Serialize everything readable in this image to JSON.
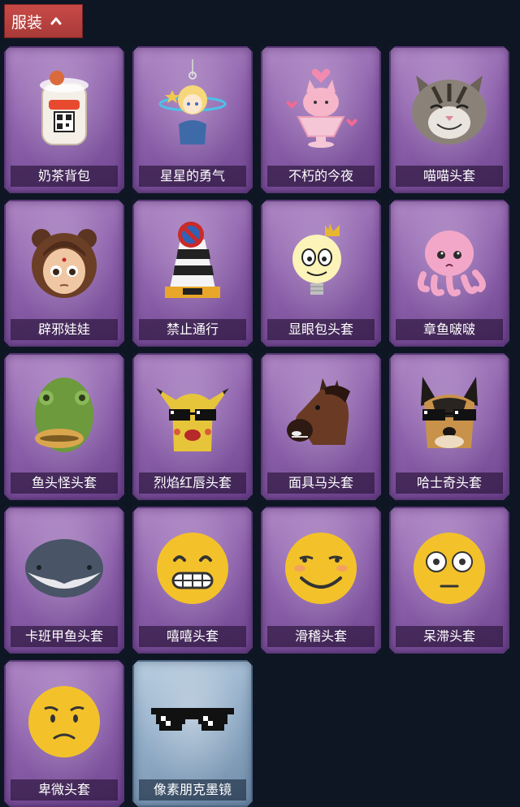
{
  "header": {
    "tab_label": "服装",
    "tab_icon": "chevron-up-icon",
    "tab_color": "#b8403e"
  },
  "items": [
    {
      "name": "奶茶背包",
      "icon": "milk-tea-backpack",
      "frame": "purple"
    },
    {
      "name": "星星的勇气",
      "icon": "star-courage-charm",
      "frame": "purple"
    },
    {
      "name": "不朽的今夜",
      "icon": "pink-fox-dessert-cup",
      "frame": "purple"
    },
    {
      "name": "喵喵头套",
      "icon": "cat-head",
      "frame": "purple"
    },
    {
      "name": "辟邪娃娃",
      "icon": "doll-head",
      "frame": "purple"
    },
    {
      "name": "禁止通行",
      "icon": "no-entry-traffic-cone",
      "frame": "purple"
    },
    {
      "name": "显眼包头套",
      "icon": "lightbulb-crown-head",
      "frame": "purple"
    },
    {
      "name": "章鱼啵啵",
      "icon": "pink-octopus",
      "frame": "purple"
    },
    {
      "name": "鱼头怪头套",
      "icon": "fish-head",
      "frame": "purple"
    },
    {
      "name": "烈焰红唇头套",
      "icon": "yellow-pikachu-sunglasses",
      "frame": "purple"
    },
    {
      "name": "面具马头套",
      "icon": "horse-head",
      "frame": "purple"
    },
    {
      "name": "哈士奇头套",
      "icon": "husky-sunglasses",
      "frame": "purple"
    },
    {
      "name": "卡班甲鱼头套",
      "icon": "gray-fish-blob",
      "frame": "purple"
    },
    {
      "name": "嘻嘻头套",
      "icon": "grinning-emoji",
      "frame": "purple"
    },
    {
      "name": "滑稽头套",
      "icon": "smirk-emoji",
      "frame": "purple"
    },
    {
      "name": "呆滞头套",
      "icon": "dazed-emoji",
      "frame": "purple"
    },
    {
      "name": "卑微头套",
      "icon": "humble-emoji",
      "frame": "purple"
    },
    {
      "name": "像素朋克墨镜",
      "icon": "pixel-sunglasses",
      "frame": "blue"
    }
  ]
}
